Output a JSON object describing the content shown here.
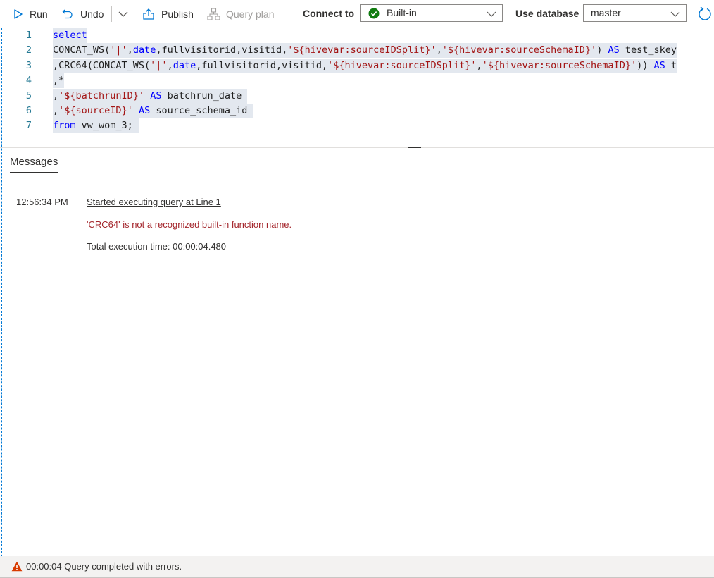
{
  "toolbar": {
    "run_label": "Run",
    "undo_label": "Undo",
    "publish_label": "Publish",
    "query_plan_label": "Query plan",
    "connect_to_label": "Connect to",
    "connect_value": "Built-in",
    "use_database_label": "Use database",
    "database_value": "master"
  },
  "editor": {
    "lines": [
      {
        "number": "1",
        "tokens": [
          {
            "t": "select",
            "c": "kw"
          }
        ]
      },
      {
        "number": "2",
        "tokens": [
          {
            "t": "CONCAT_WS(",
            "c": "tx"
          },
          {
            "t": "'|'",
            "c": "str"
          },
          {
            "t": ",",
            "c": "tx"
          },
          {
            "t": "date",
            "c": "kw"
          },
          {
            "t": ",fullvisitorid,visitid,",
            "c": "tx"
          },
          {
            "t": "'${hivevar:sourceIDSplit}'",
            "c": "str"
          },
          {
            "t": ",",
            "c": "tx"
          },
          {
            "t": "'${hivevar:sourceSchemaID}'",
            "c": "str"
          },
          {
            "t": ") ",
            "c": "tx"
          },
          {
            "t": "AS",
            "c": "kw"
          },
          {
            "t": " test_skey",
            "c": "tx"
          }
        ]
      },
      {
        "number": "3",
        "tokens": [
          {
            "t": ",CRC64(CONCAT_WS(",
            "c": "tx"
          },
          {
            "t": "'|'",
            "c": "str"
          },
          {
            "t": ",",
            "c": "tx"
          },
          {
            "t": "date",
            "c": "kw"
          },
          {
            "t": ",fullvisitorid,visitid,",
            "c": "tx"
          },
          {
            "t": "'${hivevar:sourceIDSplit}'",
            "c": "str"
          },
          {
            "t": ",",
            "c": "tx"
          },
          {
            "t": "'${hivevar:sourceSchemaID}'",
            "c": "str"
          },
          {
            "t": ")) ",
            "c": "tx"
          },
          {
            "t": "AS",
            "c": "kw"
          },
          {
            "t": " t",
            "c": "tx"
          }
        ]
      },
      {
        "number": "4",
        "tokens": [
          {
            "t": ",*",
            "c": "tx"
          }
        ]
      },
      {
        "number": "5",
        "tokens": [
          {
            "t": ",",
            "c": "tx"
          },
          {
            "t": "'${batchrunID}'",
            "c": "str"
          },
          {
            "t": " ",
            "c": "tx"
          },
          {
            "t": "AS",
            "c": "kw"
          },
          {
            "t": " batchrun_date ",
            "c": "tx"
          }
        ]
      },
      {
        "number": "6",
        "tokens": [
          {
            "t": ",",
            "c": "tx"
          },
          {
            "t": "'${sourceID}'",
            "c": "str"
          },
          {
            "t": " ",
            "c": "tx"
          },
          {
            "t": "AS",
            "c": "kw"
          },
          {
            "t": " source_schema_id ",
            "c": "tx"
          }
        ]
      },
      {
        "number": "7",
        "tokens": [
          {
            "t": "from",
            "c": "kw"
          },
          {
            "t": " vw_wom_3; ",
            "c": "tx"
          }
        ]
      }
    ]
  },
  "messages": {
    "tab_label": "Messages",
    "entries": {
      "time": "12:56:34 PM",
      "started": "Started executing query at Line 1",
      "error": "'CRC64' is not a recognized built-in function name.",
      "total": "Total execution time: 00:00:04.480"
    }
  },
  "status": {
    "text": "00:00:04 Query completed with errors."
  },
  "colors": {
    "accent": "#0078d4",
    "success": "#107c10",
    "error": "#a4262c",
    "warning": "#d83b01"
  }
}
